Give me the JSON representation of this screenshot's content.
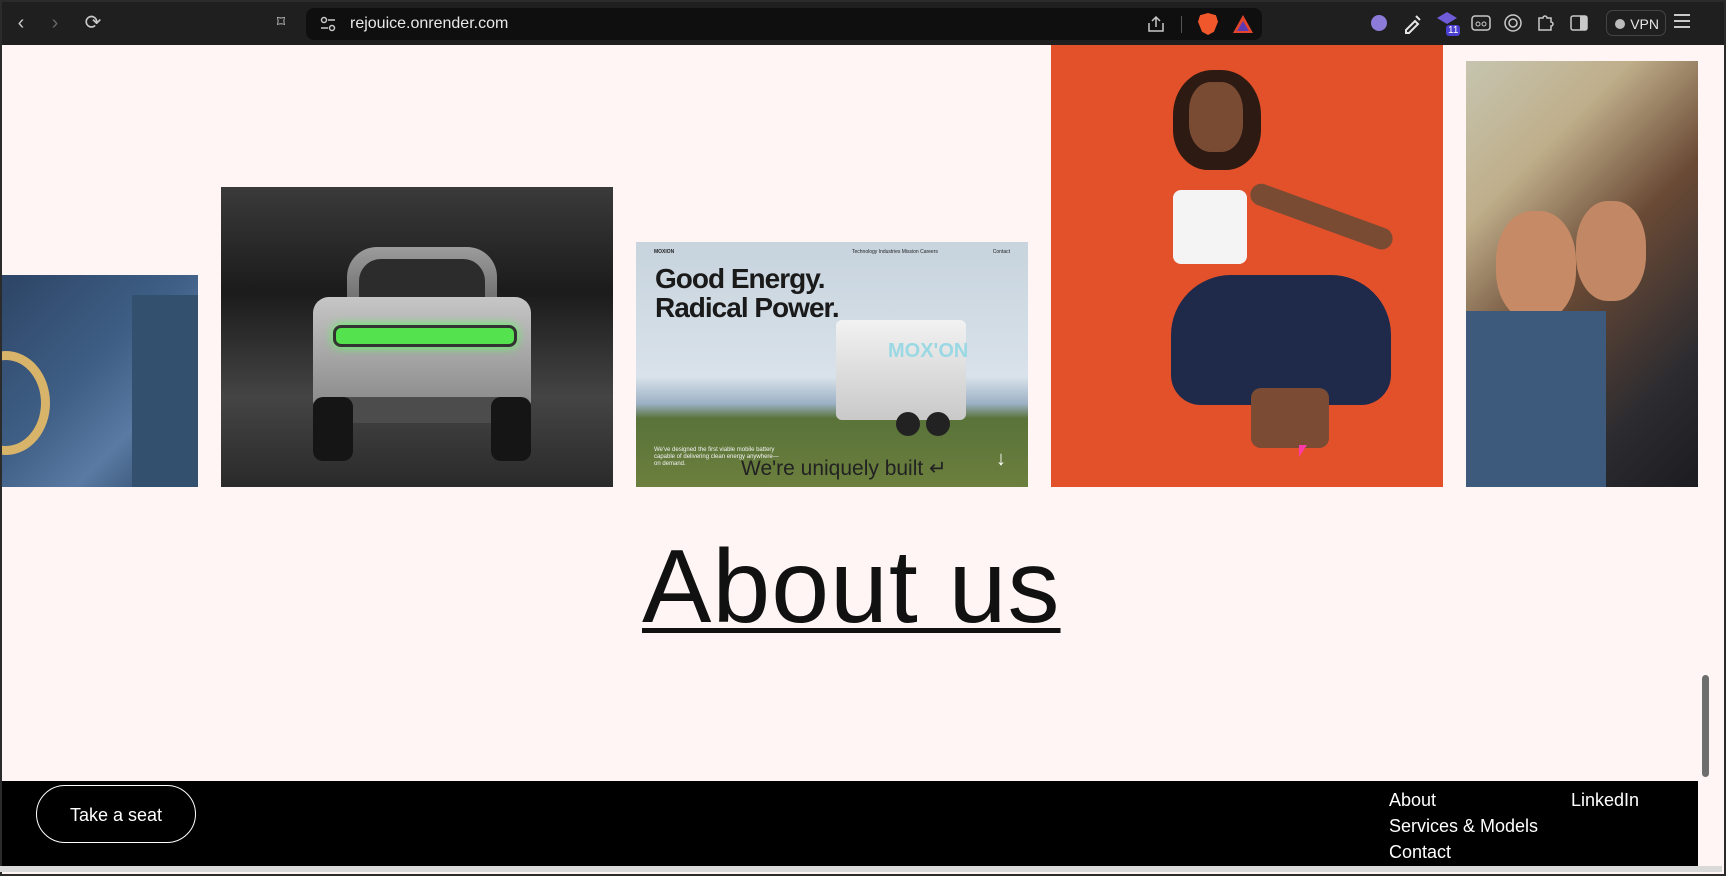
{
  "browser": {
    "url": "rejouice.onrender.com",
    "vpn_label": "VPN",
    "extension_badge": "11"
  },
  "gallery": {
    "card3": {
      "brand": "MOXION",
      "nav_links": "Technology   Industries   Mission   Careers",
      "contact": "Contact",
      "headline_line1": "Good Energy.",
      "headline_line2": "Radical Power.",
      "trailer_logo": "MOX'ON",
      "copy": "We've designed the first viable mobile battery capable of delivering clean energy anywhere— on demand."
    },
    "caption": "We're uniquely built ↵"
  },
  "main": {
    "heading": "About us"
  },
  "footer": {
    "cta": "Take a seat",
    "links": [
      "About",
      "Services & Models",
      "Contact"
    ],
    "social": "LinkedIn"
  }
}
